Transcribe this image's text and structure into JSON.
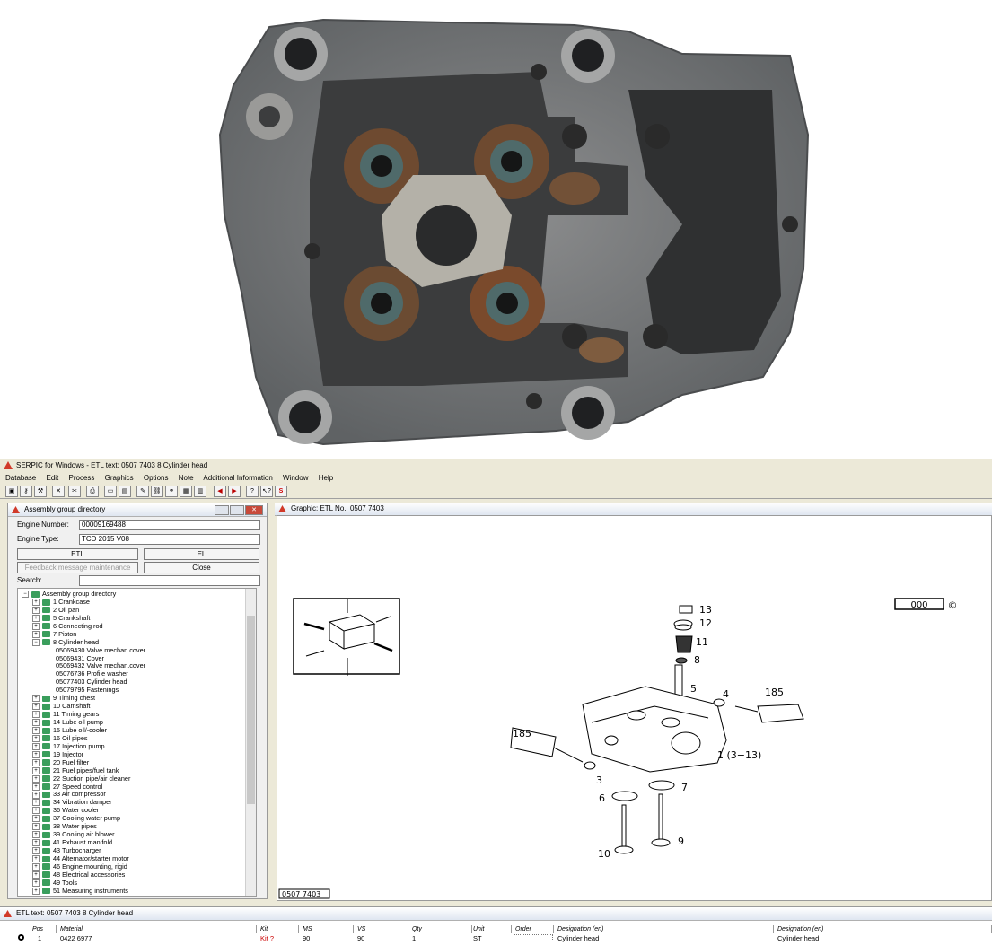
{
  "window_title": "SERPIC for Windows - ETL text: 0507 7403    8  Cylinder head",
  "menu": [
    "Database",
    "Edit",
    "Process",
    "Graphics",
    "Options",
    "Note",
    "Additional Information",
    "Window",
    "Help"
  ],
  "assembly_panel": {
    "title": "Assembly group directory",
    "engine_number_label": "Engine Number:",
    "engine_number": "00009169488",
    "engine_type_label": "Engine Type:",
    "engine_type": "TCD 2015 V08",
    "etl_button": "ETL",
    "el_button": "EL",
    "feedback_button": "Feedback message maintenance",
    "close_button": "Close",
    "search_label": "Search:",
    "tree_root": "Assembly group directory",
    "tree": [
      {
        "label": "1  Crankcase",
        "level": 1
      },
      {
        "label": "2  Oil pan",
        "level": 1
      },
      {
        "label": "5  Crankshaft",
        "level": 1
      },
      {
        "label": "6  Connecting rod",
        "level": 1
      },
      {
        "label": "7  Piston",
        "level": 1
      },
      {
        "label": "8  Cylinder head",
        "level": 1,
        "open": true
      },
      {
        "label": "05069430  Valve mechan.cover",
        "level": 2
      },
      {
        "label": "05069431  Cover",
        "level": 2
      },
      {
        "label": "05069432  Valve mechan.cover",
        "level": 2
      },
      {
        "label": "05076736  Profile washer",
        "level": 2
      },
      {
        "label": "05077403  Cylinder head",
        "level": 2
      },
      {
        "label": "05079795  Fastenings",
        "level": 2
      },
      {
        "label": "9  Timing chest",
        "level": 1
      },
      {
        "label": "10  Camshaft",
        "level": 1
      },
      {
        "label": "11  Timing gears",
        "level": 1
      },
      {
        "label": "14  Lube oil pump",
        "level": 1
      },
      {
        "label": "15  Lube oil/-cooler",
        "level": 1
      },
      {
        "label": "16  Oil pipes",
        "level": 1
      },
      {
        "label": "17  Injection pump",
        "level": 1
      },
      {
        "label": "19  Injector",
        "level": 1
      },
      {
        "label": "20  Fuel filter",
        "level": 1
      },
      {
        "label": "21  Fuel pipes/fuel tank",
        "level": 1
      },
      {
        "label": "22  Suction pipe/air cleaner",
        "level": 1
      },
      {
        "label": "27  Speed control",
        "level": 1
      },
      {
        "label": "33  Air compressor",
        "level": 1
      },
      {
        "label": "34  Vibration damper",
        "level": 1
      },
      {
        "label": "36  Water cooler",
        "level": 1
      },
      {
        "label": "37  Cooling water pump",
        "level": 1
      },
      {
        "label": "38  Water pipes",
        "level": 1
      },
      {
        "label": "39  Cooling air blower",
        "level": 1
      },
      {
        "label": "41  Exhaust manifold",
        "level": 1
      },
      {
        "label": "43  Turbocharger",
        "level": 1
      },
      {
        "label": "44  Alternator/starter motor",
        "level": 1
      },
      {
        "label": "46  Engine mounting, rigid",
        "level": 1
      },
      {
        "label": "48  Electrical accessories",
        "level": 1
      },
      {
        "label": "49  Tools",
        "level": 1
      },
      {
        "label": "51  Measuring instruments",
        "level": 1
      }
    ]
  },
  "graphic_panel": {
    "title": "Graphic: ETL No.: 0507 7403",
    "code_box": "000",
    "copyright": "©",
    "footer_id": "0507 7403",
    "callouts": [
      "13",
      "12",
      "11",
      "8",
      "5",
      "4",
      "185",
      "185",
      "1 (3−13)",
      "3",
      "6",
      "7",
      "10",
      "9"
    ]
  },
  "etl_table": {
    "title": "ETL text: 0507 7403    8  Cylinder head",
    "headers": [
      "Pos",
      "Material",
      "Kit",
      "MS",
      "VS",
      "Qty",
      "Unit",
      "Order",
      "Designation (en)",
      "Designation (en)"
    ],
    "row": [
      "1",
      "0422 6977",
      "Kit ?",
      "90",
      "90",
      "1",
      "ST",
      "",
      "Cylinder head",
      "Cylinder head"
    ]
  }
}
